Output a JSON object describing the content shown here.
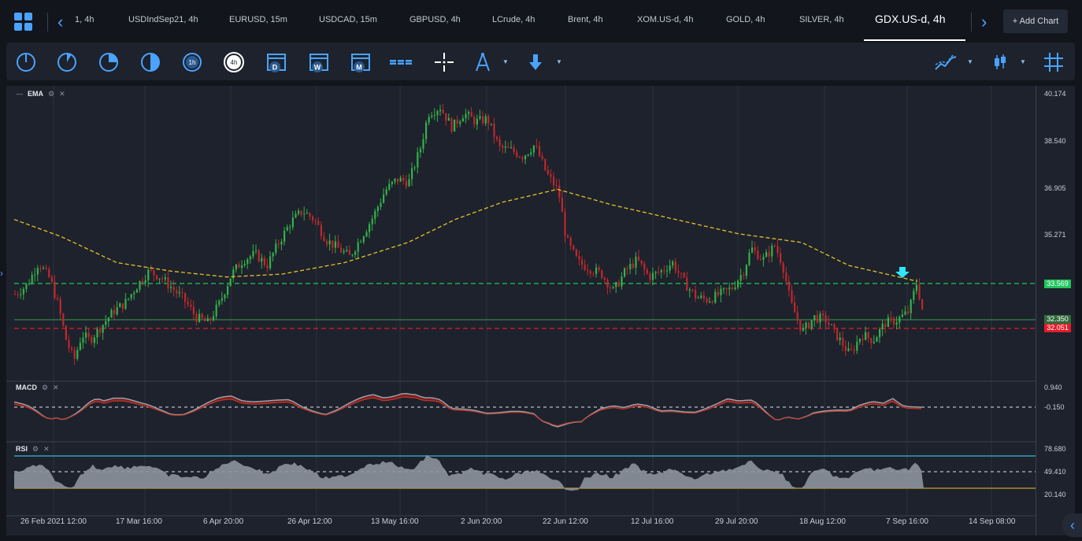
{
  "tabs": [
    {
      "label": "1, 4h"
    },
    {
      "label": "USDIndSep21, 4h"
    },
    {
      "label": "EURUSD, 15m"
    },
    {
      "label": "USDCAD, 15m"
    },
    {
      "label": "GBPUSD, 4h"
    },
    {
      "label": "LCrude, 4h"
    },
    {
      "label": "Brent, 4h"
    },
    {
      "label": "XOM.US-d, 4h"
    },
    {
      "label": "GOLD, 4h"
    },
    {
      "label": "SILVER, 4h"
    },
    {
      "label": "GDX.US-d, 4h"
    }
  ],
  "active_tab": "GDX.US-d, 4h",
  "add_chart_label": "+ Add Chart",
  "toolbar": {
    "timeframe_tools": [
      "circle-1m-icon",
      "circle-5m-icon",
      "circle-15m-icon",
      "circle-30m-icon",
      "circle-1h-icon",
      "circle-4h-icon"
    ],
    "period_labels": [
      "D",
      "W",
      "M"
    ],
    "hour_labels": [
      "1h",
      "4h"
    ],
    "active_timeframe": "4h"
  },
  "indicators": {
    "main": "EMA",
    "macd": "MACD",
    "rsi": "RSI"
  },
  "price_axis": {
    "labels": [
      "40.174",
      "38.540",
      "36.905",
      "35.271"
    ],
    "badges": [
      {
        "value": "33.569",
        "color": "#22c55e"
      },
      {
        "value": "32.350",
        "color": "#2f6b3a"
      },
      {
        "value": "32.051",
        "color": "#e11d2a"
      }
    ]
  },
  "macd_axis": {
    "labels": [
      "0.940",
      "-0.150"
    ]
  },
  "rsi_axis": {
    "labels": [
      "78.680",
      "49.410",
      "20.140"
    ]
  },
  "time_axis": {
    "labels": [
      "26 Feb 2021 12:00",
      "17 Mar 16:00",
      "6 Apr 20:00",
      "26 Apr 12:00",
      "13 May 16:00",
      "2 Jun 20:00",
      "22 Jun 12:00",
      "12 Jul 16:00",
      "29 Jul 20:00",
      "18 Aug 12:00",
      "7 Sep 16:00",
      "14 Sep 08:00"
    ]
  },
  "chart_data": {
    "type": "candlestick",
    "price_points": [
      [
        0,
        33.2
      ],
      [
        15,
        33.5
      ],
      [
        30,
        34.3
      ],
      [
        45,
        33.7
      ],
      [
        55,
        32.8
      ],
      [
        65,
        31.6
      ],
      [
        75,
        30.9
      ],
      [
        85,
        31.8
      ],
      [
        95,
        31.6
      ],
      [
        110,
        32.1
      ],
      [
        125,
        32.6
      ],
      [
        140,
        32.9
      ],
      [
        155,
        33.5
      ],
      [
        170,
        34.0
      ],
      [
        185,
        33.8
      ],
      [
        200,
        33.4
      ],
      [
        215,
        33.0
      ],
      [
        230,
        32.4
      ],
      [
        245,
        32.2
      ],
      [
        260,
        32.9
      ],
      [
        275,
        33.9
      ],
      [
        290,
        34.4
      ],
      [
        305,
        34.6
      ],
      [
        320,
        34.2
      ],
      [
        335,
        35.0
      ],
      [
        350,
        35.7
      ],
      [
        365,
        36.1
      ],
      [
        380,
        35.8
      ],
      [
        395,
        35.1
      ],
      [
        410,
        34.8
      ],
      [
        425,
        34.5
      ],
      [
        440,
        35.2
      ],
      [
        455,
        35.9
      ],
      [
        470,
        36.8
      ],
      [
        485,
        37.2
      ],
      [
        500,
        37.1
      ],
      [
        515,
        38.3
      ],
      [
        525,
        39.5
      ],
      [
        540,
        39.7
      ],
      [
        555,
        39.0
      ],
      [
        570,
        39.5
      ],
      [
        585,
        39.2
      ],
      [
        600,
        39.3
      ],
      [
        615,
        38.3
      ],
      [
        630,
        38.2
      ],
      [
        645,
        38.0
      ],
      [
        660,
        38.4
      ],
      [
        675,
        37.4
      ],
      [
        690,
        36.8
      ],
      [
        700,
        35.1
      ],
      [
        715,
        34.3
      ],
      [
        730,
        34.1
      ],
      [
        745,
        33.9
      ],
      [
        760,
        33.3
      ],
      [
        775,
        34.0
      ],
      [
        790,
        34.4
      ],
      [
        805,
        33.8
      ],
      [
        820,
        34.0
      ],
      [
        835,
        34.3
      ],
      [
        850,
        33.6
      ],
      [
        865,
        33.1
      ],
      [
        880,
        33.0
      ],
      [
        895,
        33.2
      ],
      [
        910,
        33.4
      ],
      [
        925,
        34.0
      ],
      [
        935,
        34.8
      ],
      [
        950,
        34.4
      ],
      [
        965,
        34.9
      ],
      [
        975,
        34.2
      ],
      [
        985,
        32.9
      ],
      [
        1000,
        31.9
      ],
      [
        1015,
        32.4
      ],
      [
        1030,
        32.3
      ],
      [
        1045,
        31.7
      ],
      [
        1060,
        31.1
      ],
      [
        1075,
        31.8
      ],
      [
        1090,
        31.6
      ],
      [
        1105,
        32.2
      ],
      [
        1120,
        32.3
      ],
      [
        1135,
        32.6
      ],
      [
        1145,
        33.6
      ],
      [
        1155,
        32.3
      ]
    ],
    "ema_points": [
      [
        0,
        35.8
      ],
      [
        60,
        35.2
      ],
      [
        130,
        34.3
      ],
      [
        200,
        34.0
      ],
      [
        270,
        33.8
      ],
      [
        340,
        33.9
      ],
      [
        420,
        34.3
      ],
      [
        500,
        35.0
      ],
      [
        560,
        35.8
      ],
      [
        620,
        36.4
      ],
      [
        690,
        36.85
      ],
      [
        760,
        36.3
      ],
      [
        840,
        35.8
      ],
      [
        920,
        35.3
      ],
      [
        1000,
        35.0
      ],
      [
        1060,
        34.2
      ],
      [
        1147,
        33.65
      ]
    ],
    "levels": [
      33.569,
      32.35,
      32.051
    ],
    "macd_axis_labels": [
      0.94,
      -0.15
    ],
    "rsi_levels": [
      78.68,
      49.41,
      20.14
    ]
  }
}
